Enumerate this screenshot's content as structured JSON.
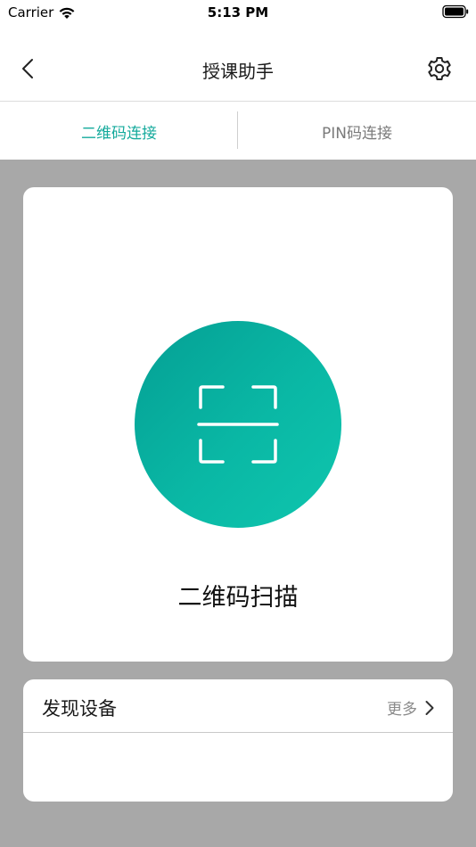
{
  "status_bar": {
    "carrier": "Carrier",
    "time": "5:13 PM"
  },
  "nav": {
    "title": "授课助手"
  },
  "tabs": [
    {
      "label": "二维码连接",
      "active": true
    },
    {
      "label": "PIN码连接",
      "active": false
    }
  ],
  "scan": {
    "label": "二维码扫描"
  },
  "devices": {
    "title": "发现设备",
    "more_label": "更多"
  },
  "colors": {
    "accent": "#14aa9c",
    "background": "#a8a8a8"
  }
}
